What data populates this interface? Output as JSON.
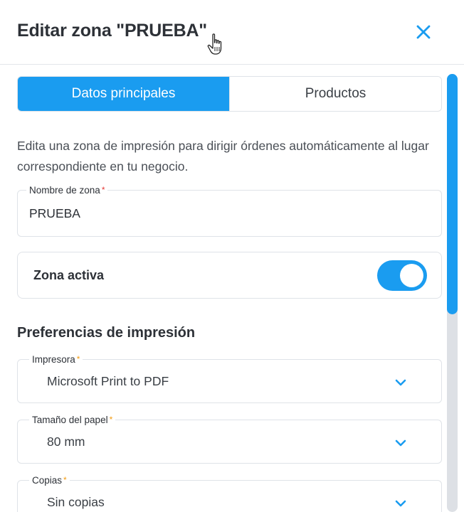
{
  "header": {
    "title": "Editar zona \"PRUEBA\""
  },
  "tabs": [
    {
      "label": "Datos principales",
      "active": true
    },
    {
      "label": "Productos",
      "active": false
    }
  ],
  "description": "Edita una zona de impresión para dirigir órdenes automáticamente al lugar correspondiente en tu negocio.",
  "zone_name": {
    "label": "Nombre de zona",
    "required_mark": "*",
    "value": "PRUEBA"
  },
  "active_toggle": {
    "label": "Zona activa",
    "on": true
  },
  "print_prefs": {
    "title": "Preferencias de impresión",
    "printer": {
      "label": "Impresora",
      "required_mark": "*",
      "value": "Microsoft Print to PDF"
    },
    "paper_size": {
      "label": "Tamaño del papel",
      "required_mark": "*",
      "value": "80 mm"
    },
    "copies": {
      "label": "Copias",
      "required_mark": "*",
      "value": "Sin copias"
    }
  },
  "icons": {
    "close": "close-icon",
    "chevron": "chevron-down-icon",
    "cursor": "hand-pointer-icon"
  },
  "colors": {
    "accent": "#1a9cf0",
    "required_red": "#e53935",
    "required_orange": "#f39c12"
  }
}
